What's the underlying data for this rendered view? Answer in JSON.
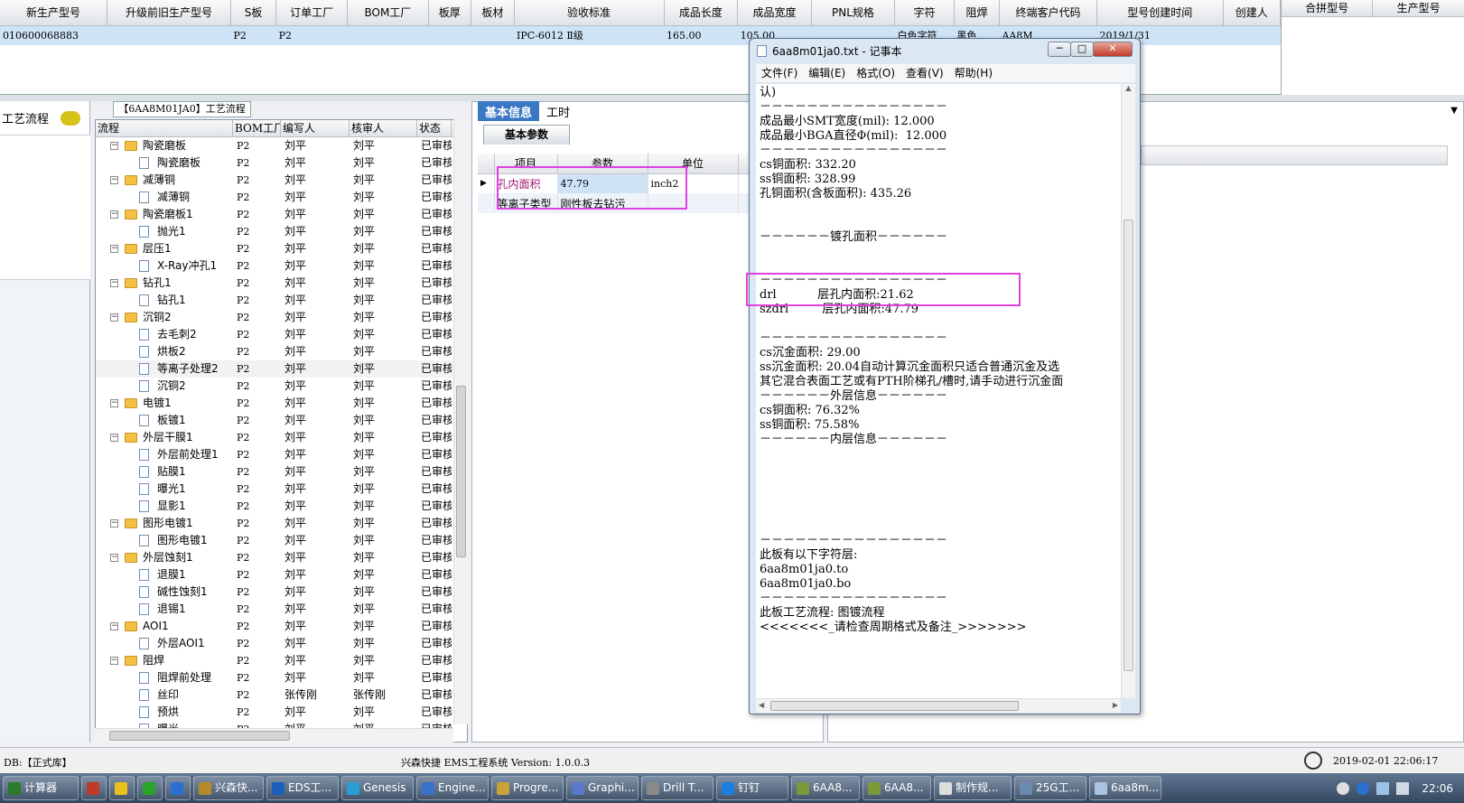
{
  "top_grid": {
    "headers": [
      "新生产型号",
      "升级前旧生产型号",
      "S板",
      "订单工厂",
      "BOM工厂",
      "板厚",
      "板材",
      "验收标准",
      "成品长度",
      "成品宽度",
      "PNL规格",
      "字符",
      "阻焊",
      "终端客户代码",
      "型号创建时间",
      "创建人"
    ],
    "row": [
      "010600068883",
      "",
      "P2",
      "P2",
      "",
      "",
      "",
      "IPC-6012 Ⅱ级",
      "165.00",
      "105.00",
      "",
      "白色字符",
      "黑色",
      "AA8M",
      "2019/1/31",
      ""
    ],
    "right_headers": [
      "合拼型号",
      "生产型号"
    ]
  },
  "left_pane": {
    "title": "工艺流程"
  },
  "tree": {
    "title": "【6AA8M01JA0】工艺流程",
    "headers": [
      "流程",
      "BOM工厂",
      "编写人",
      "核审人",
      "状态"
    ],
    "rows": [
      {
        "level": 1,
        "name": "陶瓷磨板",
        "bom": "P2",
        "writer": "刘平",
        "reviewer": "刘平",
        "status": "已审核"
      },
      {
        "level": 2,
        "name": "陶瓷磨板",
        "bom": "P2",
        "writer": "刘平",
        "reviewer": "刘平",
        "status": "已审核"
      },
      {
        "level": 1,
        "name": "减薄铜",
        "bom": "P2",
        "writer": "刘平",
        "reviewer": "刘平",
        "status": "已审核"
      },
      {
        "level": 2,
        "name": "减薄铜",
        "bom": "P2",
        "writer": "刘平",
        "reviewer": "刘平",
        "status": "已审核"
      },
      {
        "level": 1,
        "name": "陶瓷磨板1",
        "bom": "P2",
        "writer": "刘平",
        "reviewer": "刘平",
        "status": "已审核"
      },
      {
        "level": 2,
        "name": "抛光1",
        "bom": "P2",
        "writer": "刘平",
        "reviewer": "刘平",
        "status": "已审核"
      },
      {
        "level": 1,
        "name": "层压1",
        "bom": "P2",
        "writer": "刘平",
        "reviewer": "刘平",
        "status": "已审核"
      },
      {
        "level": 2,
        "name": "X-Ray冲孔1",
        "bom": "P2",
        "writer": "刘平",
        "reviewer": "刘平",
        "status": "已审核"
      },
      {
        "level": 1,
        "name": "钻孔1",
        "bom": "P2",
        "writer": "刘平",
        "reviewer": "刘平",
        "status": "已审核"
      },
      {
        "level": 2,
        "name": "钻孔1",
        "bom": "P2",
        "writer": "刘平",
        "reviewer": "刘平",
        "status": "已审核"
      },
      {
        "level": 1,
        "name": "沉铜2",
        "bom": "P2",
        "writer": "刘平",
        "reviewer": "刘平",
        "status": "已审核"
      },
      {
        "level": 2,
        "name": "去毛刺2",
        "bom": "P2",
        "writer": "刘平",
        "reviewer": "刘平",
        "status": "已审核"
      },
      {
        "level": 2,
        "name": "烘板2",
        "bom": "P2",
        "writer": "刘平",
        "reviewer": "刘平",
        "status": "已审核"
      },
      {
        "level": 2,
        "name": "等离子处理2",
        "bom": "P2",
        "writer": "刘平",
        "reviewer": "刘平",
        "status": "已审核",
        "selected": true
      },
      {
        "level": 2,
        "name": "沉铜2",
        "bom": "P2",
        "writer": "刘平",
        "reviewer": "刘平",
        "status": "已审核"
      },
      {
        "level": 1,
        "name": "电镀1",
        "bom": "P2",
        "writer": "刘平",
        "reviewer": "刘平",
        "status": "已审核"
      },
      {
        "level": 2,
        "name": "板镀1",
        "bom": "P2",
        "writer": "刘平",
        "reviewer": "刘平",
        "status": "已审核"
      },
      {
        "level": 1,
        "name": "外层干膜1",
        "bom": "P2",
        "writer": "刘平",
        "reviewer": "刘平",
        "status": "已审核"
      },
      {
        "level": 2,
        "name": "外层前处理1",
        "bom": "P2",
        "writer": "刘平",
        "reviewer": "刘平",
        "status": "已审核"
      },
      {
        "level": 2,
        "name": "贴膜1",
        "bom": "P2",
        "writer": "刘平",
        "reviewer": "刘平",
        "status": "已审核"
      },
      {
        "level": 2,
        "name": "曝光1",
        "bom": "P2",
        "writer": "刘平",
        "reviewer": "刘平",
        "status": "已审核"
      },
      {
        "level": 2,
        "name": "显影1",
        "bom": "P2",
        "writer": "刘平",
        "reviewer": "刘平",
        "status": "已审核"
      },
      {
        "level": 1,
        "name": "图形电镀1",
        "bom": "P2",
        "writer": "刘平",
        "reviewer": "刘平",
        "status": "已审核"
      },
      {
        "level": 2,
        "name": "图形电镀1",
        "bom": "P2",
        "writer": "刘平",
        "reviewer": "刘平",
        "status": "已审核"
      },
      {
        "level": 1,
        "name": "外层蚀刻1",
        "bom": "P2",
        "writer": "刘平",
        "reviewer": "刘平",
        "status": "已审核"
      },
      {
        "level": 2,
        "name": "退膜1",
        "bom": "P2",
        "writer": "刘平",
        "reviewer": "刘平",
        "status": "已审核"
      },
      {
        "level": 2,
        "name": "碱性蚀刻1",
        "bom": "P2",
        "writer": "刘平",
        "reviewer": "刘平",
        "status": "已审核"
      },
      {
        "level": 2,
        "name": "退锡1",
        "bom": "P2",
        "writer": "刘平",
        "reviewer": "刘平",
        "status": "已审核"
      },
      {
        "level": 1,
        "name": "AOI1",
        "bom": "P2",
        "writer": "刘平",
        "reviewer": "刘平",
        "status": "已审核"
      },
      {
        "level": 2,
        "name": "外层AOI1",
        "bom": "P2",
        "writer": "刘平",
        "reviewer": "刘平",
        "status": "已审核"
      },
      {
        "level": 1,
        "name": "阻焊",
        "bom": "P2",
        "writer": "刘平",
        "reviewer": "刘平",
        "status": "已审核"
      },
      {
        "level": 2,
        "name": "阻焊前处理",
        "bom": "P2",
        "writer": "刘平",
        "reviewer": "刘平",
        "status": "已审核"
      },
      {
        "level": 2,
        "name": "丝印",
        "bom": "P2",
        "writer": "张传刚",
        "reviewer": "张传刚",
        "status": "已审核"
      },
      {
        "level": 2,
        "name": "预烘",
        "bom": "P2",
        "writer": "刘平",
        "reviewer": "刘平",
        "status": "已审核"
      },
      {
        "level": 2,
        "name": "曝光",
        "bom": "P2",
        "writer": "刘平",
        "reviewer": "刘平",
        "status": "已审核"
      }
    ]
  },
  "mid_pane": {
    "tabs": [
      "基本信息",
      "工时"
    ],
    "subtab": "基本参数",
    "param_headers": [
      "项目",
      "参数",
      "单位"
    ],
    "params": [
      {
        "item": "孔内面积",
        "value": "47.79",
        "unit": "inch2"
      },
      {
        "item": "等离子类型",
        "value": "刚性板去钻污",
        "unit": ""
      }
    ]
  },
  "notepad": {
    "title": "6aa8m01ja0.txt - 记事本",
    "menu": [
      "文件(F)",
      "编辑(E)",
      "格式(O)",
      "查看(V)",
      "帮助(H)"
    ],
    "lines": [
      "认)",
      "－－－－－－－－－－－－－－－－",
      "成品最小SMT宽度(mil): 12.000",
      "成品最小BGA直径Φ(mil):  12.000",
      "－－－－－－－－－－－－－－－－",
      "cs铜面积: 332.20",
      "ss铜面积: 328.99",
      "孔铜面积(含板面积): 435.26",
      "",
      "",
      "－－－－－－镀孔面积－－－－－－",
      "",
      "",
      "－－－－－－－－－－－－－－－－",
      "drl           层孔内面积:21.62",
      "szdrl         层孔内面积:47.79",
      "",
      "－－－－－－－－－－－－－－－－",
      "cs沉金面积: 29.00",
      "ss沉金面积: 20.04自动计算沉金面积只适合普通沉金及选",
      "其它混合表面工艺或有PTH阶梯孔/槽时,请手动进行沉金面",
      "－－－－－－外层信息－－－－－－",
      "cs铜面积: 76.32%",
      "ss铜面积: 75.58%",
      "－－－－－－内层信息－－－－－－",
      "",
      "",
      "",
      "",
      "",
      "",
      "－－－－－－－－－－－－－－－－",
      "此板有以下字符层:",
      "6aa8m01ja0.to",
      "6aa8m01ja0.bo",
      "－－－－－－－－－－－－－－－－",
      "此板工艺流程: 图镀流程",
      "<<<<<<<_请检查周期格式及备注_>>>>>>>"
    ]
  },
  "status_bar": {
    "db": "DB:【正式库】",
    "system": "兴森快捷 EMS工程系统 Version: 1.0.0.3",
    "datetime": "2019-02-01 22:06:17"
  },
  "taskbar": {
    "items": [
      "计算器",
      "",
      "",
      "",
      "",
      "兴森快...",
      "EDS工...",
      "Genesis",
      "Engine...",
      "Progre...",
      "Graphi...",
      "Drill T...",
      "钉钉",
      "6AA8...",
      "6AA8...",
      "制作规...",
      "25G工...",
      "6aa8m..."
    ],
    "clock": "22:06"
  },
  "colors": {
    "accent": "#3a78c4",
    "highlight": "#e040e0",
    "row_select": "#cfe3f7",
    "folder": "#f3c041"
  }
}
